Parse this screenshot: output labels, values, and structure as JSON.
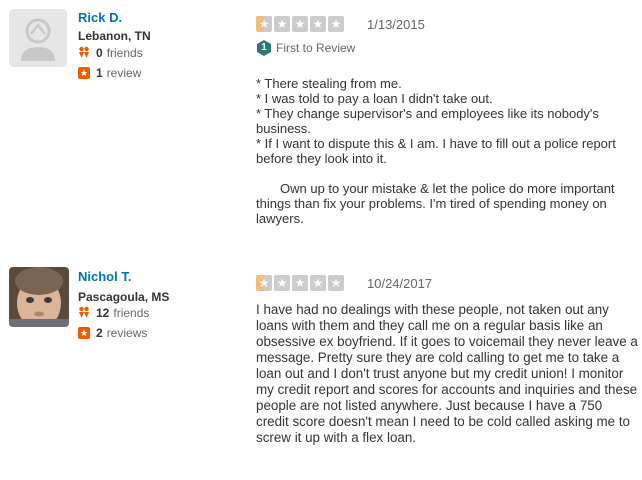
{
  "reviews": [
    {
      "user": {
        "name": "Rick D.",
        "location": "Lebanon, TN",
        "friends": "0",
        "friends_label": "friends",
        "reviews": "1",
        "reviews_label": "review"
      },
      "rating": 1,
      "date": "1/13/2015",
      "badge": "First to Review",
      "text": [
        "* There stealing from me.",
        "* I was told to pay a loan I didn't take out.",
        "* They change supervisor's and employees like its nobody's business.",
        "* If I want to dispute this & I am. I have to fill out a police report before they look into it.",
        "Own up to your mistake & let the police do more important things than fix your problems. I'm tired of spending money on lawyers."
      ]
    },
    {
      "user": {
        "name": "Nichol T.",
        "location": "Pascagoula, MS",
        "friends": "12",
        "friends_label": "friends",
        "reviews": "2",
        "reviews_label": "reviews"
      },
      "rating": 1,
      "date": "10/24/2017",
      "text": [
        "I have had no dealings with these people, not taken out any loans with them and they call me on a regular basis like an obsessive ex boyfriend. If it goes to voicemail they never leave a message. Pretty sure they are cold calling to get me to take a loan out and I don't trust anyone but my credit union! I monitor my credit report and scores for accounts and inquiries and these people are not listed anywhere. Just because I have a 750 credit score doesn't mean I need to be cold called asking me to screw it up with a flex loan."
      ]
    }
  ],
  "colors": {
    "name": "#0073bb",
    "star_filled": "#f2bd79",
    "star_empty": "#cccccc",
    "review_icon": "#f15c00",
    "first_badge": "#2a7a7a"
  },
  "icons": {
    "star": "star-icon",
    "friends": "friends-icon",
    "review": "review-icon",
    "first_to_review": "first-to-review-icon"
  }
}
